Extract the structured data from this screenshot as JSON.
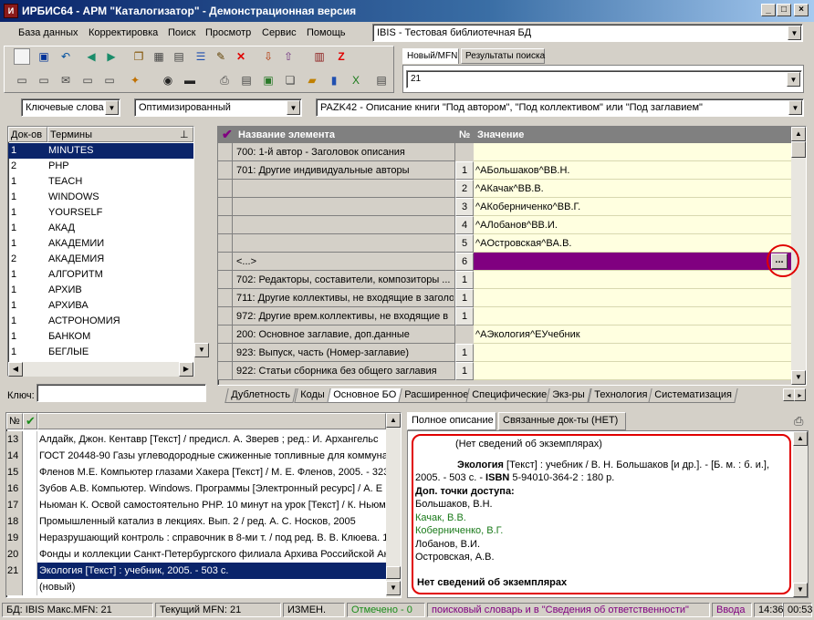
{
  "window": {
    "title": "ИРБИС64 - АРМ \"Каталогизатор\" - Демонстрационная версия"
  },
  "menu": [
    "База данных",
    "Корректировка",
    "Поиск",
    "Просмотр",
    "Сервис",
    "Помощь"
  ],
  "db_combo": "IBIS - Тестовая библиотечная БД",
  "right_tabs": [
    "Новый/MFN",
    "Результаты поиска"
  ],
  "mfn_combo": "21",
  "search_bar": {
    "mode": "Ключевые слова",
    "opt": "Оптимизированный",
    "worksheet": "PAZK42 - Описание книги \"Под автором\", \"Под коллективом\" или \"Под заглавием\""
  },
  "dict": {
    "headers": [
      "Док-ов",
      "Термины"
    ],
    "rows": [
      {
        "n": "1",
        "t": "MINUTES"
      },
      {
        "n": "2",
        "t": "PHP"
      },
      {
        "n": "1",
        "t": "TEACH"
      },
      {
        "n": "1",
        "t": "WINDOWS"
      },
      {
        "n": "1",
        "t": "YOURSELF"
      },
      {
        "n": "1",
        "t": "АКАД"
      },
      {
        "n": "1",
        "t": "АКАДЕМИИ"
      },
      {
        "n": "2",
        "t": "АКАДЕМИЯ"
      },
      {
        "n": "1",
        "t": "АЛГОРИТМ"
      },
      {
        "n": "1",
        "t": "АРХИВ"
      },
      {
        "n": "1",
        "t": "АРХИВА"
      },
      {
        "n": "1",
        "t": "АСТРОНОМИЯ"
      },
      {
        "n": "1",
        "t": "БАНКОМ"
      },
      {
        "n": "1",
        "t": "БЕГЛЫЕ"
      }
    ],
    "key_label": "Ключ:"
  },
  "editor": {
    "headers": [
      "Название элемента",
      "№",
      "Значение"
    ],
    "rows": [
      {
        "name": "700: 1-й автор - Заголовок описания",
        "num": "",
        "val": ""
      },
      {
        "name": "701: Другие индивидуальные авторы",
        "num": "1",
        "val": "^AБольшаков^BB.Н."
      },
      {
        "name": "",
        "num": "2",
        "val": "^AКачак^BB.B."
      },
      {
        "name": "",
        "num": "3",
        "val": "^AКоберниченко^BB.Г."
      },
      {
        "name": "",
        "num": "4",
        "val": "^AЛобанов^BB.И."
      },
      {
        "name": "",
        "num": "5",
        "val": "^AОстровская^BA.B."
      },
      {
        "name": "<...>",
        "num": "6",
        "val": ""
      },
      {
        "name": "702: Редакторы, составители, композиторы ...",
        "num": "1",
        "val": ""
      },
      {
        "name": "711: Другие коллективы, не входящие в заголо",
        "num": "1",
        "val": ""
      },
      {
        "name": "972: Другие врем.коллективы, не входящие в",
        "num": "1",
        "val": ""
      },
      {
        "name": "200: Основное заглавие, доп.данные",
        "num": "",
        "val": "^AЭкология^EУчебник"
      },
      {
        "name": "923: Выпуск, часть (Номер-заглавие)",
        "num": "1",
        "val": ""
      },
      {
        "name": "922: Статьи сборника без общего заглавия",
        "num": "1",
        "val": ""
      }
    ],
    "ellipsis": "...",
    "tabs": [
      "Дублетность",
      "Коды",
      "Основное БО",
      "Расширенное",
      "Специфические",
      "Экз-ры",
      "Технология",
      "Систематизация"
    ]
  },
  "records": {
    "header_num": "№",
    "rows": [
      {
        "n": "13",
        "t": "Алдайк, Джон. Кентавр [Текст] / предисл. А. Зверев ; ред.: И. Архангельс"
      },
      {
        "n": "14",
        "t": "ГОСТ 20448-90 Газы углеводородные сжиженные топливные для коммуна"
      },
      {
        "n": "15",
        "t": "Фленов М.Е. Компьютер глазами Хакера [Текст] / М. Е. Фленов, 2005. - 323"
      },
      {
        "n": "16",
        "t": "Зубов А.В. Компьютер. Windows. Программы [Электронный ресурс] / А. Е"
      },
      {
        "n": "17",
        "t": "Ньюман К. Освой самостоятельно PHP. 10 минут на урок [Текст] / К. Ньюм"
      },
      {
        "n": "18",
        "t": "Промышленный катализ в лекциях. Вып. 2 / ред. А. С. Носков, 2005"
      },
      {
        "n": "19",
        "t": "Неразрушающий контроль : справочник в 8-ми т. / под ред. В. В. Клюева. 1"
      },
      {
        "n": "20",
        "t": "Фонды и коллекции Санкт-Петербургского филиала Архива Российской Ак"
      },
      {
        "n": "21",
        "t": "Экология [Текст] : учебник, 2005. - 503 с."
      },
      {
        "n": "",
        "t": "(новый)"
      }
    ]
  },
  "desc": {
    "tabs": [
      "Полное описание",
      "Связанные док-ты (НЕТ)"
    ],
    "line1": "(Нет сведений об экземплярах)",
    "title_bold": "Экология",
    "title_rest": " [Текст] : учебник / В. Н. Большаков [и др.]. - [Б. м. : б. и.],",
    "line3a": "2005. - 503 с. - ",
    "isbn_label": "ISBN",
    "line3b": " 5-94010-364-2 : 180 р.",
    "access_label": "Доп. точки доступа:",
    "authors": [
      "Большаков, В.Н.",
      "Качак, В.В.",
      "Коберниченко, В.Г.",
      "Лобанов, В.И.",
      "Островская, А.В."
    ],
    "footer": "Нет сведений об экземплярах"
  },
  "status": {
    "db": "БД: IBIS Макс.MFN: 21",
    "cur": "Текущий MFN: 21",
    "changed": "ИЗМЕН.",
    "marked": "Отмечено - 0",
    "hint": "поисковый словарь и в \"Сведения об ответственности\"",
    "input": "Вводa",
    "time1": "14:36",
    "time2": "00:53"
  },
  "colors": {
    "title_start": "#0a246a",
    "selection": "#0a246a",
    "highlight_row": "#800080",
    "value_bg": "#ffffe0"
  }
}
